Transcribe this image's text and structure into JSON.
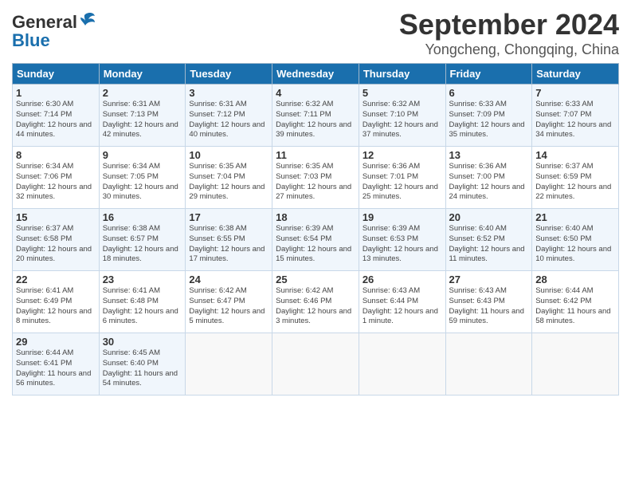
{
  "header": {
    "logo_general": "General",
    "logo_blue": "Blue",
    "month_title": "September 2024",
    "location": "Yongcheng, Chongqing, China"
  },
  "weekdays": [
    "Sunday",
    "Monday",
    "Tuesday",
    "Wednesday",
    "Thursday",
    "Friday",
    "Saturday"
  ],
  "weeks": [
    [
      {
        "day": "1",
        "sunrise": "6:30 AM",
        "sunset": "7:14 PM",
        "daylight": "12 hours and 44 minutes."
      },
      {
        "day": "2",
        "sunrise": "6:31 AM",
        "sunset": "7:13 PM",
        "daylight": "12 hours and 42 minutes."
      },
      {
        "day": "3",
        "sunrise": "6:31 AM",
        "sunset": "7:12 PM",
        "daylight": "12 hours and 40 minutes."
      },
      {
        "day": "4",
        "sunrise": "6:32 AM",
        "sunset": "7:11 PM",
        "daylight": "12 hours and 39 minutes."
      },
      {
        "day": "5",
        "sunrise": "6:32 AM",
        "sunset": "7:10 PM",
        "daylight": "12 hours and 37 minutes."
      },
      {
        "day": "6",
        "sunrise": "6:33 AM",
        "sunset": "7:09 PM",
        "daylight": "12 hours and 35 minutes."
      },
      {
        "day": "7",
        "sunrise": "6:33 AM",
        "sunset": "7:07 PM",
        "daylight": "12 hours and 34 minutes."
      }
    ],
    [
      {
        "day": "8",
        "sunrise": "6:34 AM",
        "sunset": "7:06 PM",
        "daylight": "12 hours and 32 minutes."
      },
      {
        "day": "9",
        "sunrise": "6:34 AM",
        "sunset": "7:05 PM",
        "daylight": "12 hours and 30 minutes."
      },
      {
        "day": "10",
        "sunrise": "6:35 AM",
        "sunset": "7:04 PM",
        "daylight": "12 hours and 29 minutes."
      },
      {
        "day": "11",
        "sunrise": "6:35 AM",
        "sunset": "7:03 PM",
        "daylight": "12 hours and 27 minutes."
      },
      {
        "day": "12",
        "sunrise": "6:36 AM",
        "sunset": "7:01 PM",
        "daylight": "12 hours and 25 minutes."
      },
      {
        "day": "13",
        "sunrise": "6:36 AM",
        "sunset": "7:00 PM",
        "daylight": "12 hours and 24 minutes."
      },
      {
        "day": "14",
        "sunrise": "6:37 AM",
        "sunset": "6:59 PM",
        "daylight": "12 hours and 22 minutes."
      }
    ],
    [
      {
        "day": "15",
        "sunrise": "6:37 AM",
        "sunset": "6:58 PM",
        "daylight": "12 hours and 20 minutes."
      },
      {
        "day": "16",
        "sunrise": "6:38 AM",
        "sunset": "6:57 PM",
        "daylight": "12 hours and 18 minutes."
      },
      {
        "day": "17",
        "sunrise": "6:38 AM",
        "sunset": "6:55 PM",
        "daylight": "12 hours and 17 minutes."
      },
      {
        "day": "18",
        "sunrise": "6:39 AM",
        "sunset": "6:54 PM",
        "daylight": "12 hours and 15 minutes."
      },
      {
        "day": "19",
        "sunrise": "6:39 AM",
        "sunset": "6:53 PM",
        "daylight": "12 hours and 13 minutes."
      },
      {
        "day": "20",
        "sunrise": "6:40 AM",
        "sunset": "6:52 PM",
        "daylight": "12 hours and 11 minutes."
      },
      {
        "day": "21",
        "sunrise": "6:40 AM",
        "sunset": "6:50 PM",
        "daylight": "12 hours and 10 minutes."
      }
    ],
    [
      {
        "day": "22",
        "sunrise": "6:41 AM",
        "sunset": "6:49 PM",
        "daylight": "12 hours and 8 minutes."
      },
      {
        "day": "23",
        "sunrise": "6:41 AM",
        "sunset": "6:48 PM",
        "daylight": "12 hours and 6 minutes."
      },
      {
        "day": "24",
        "sunrise": "6:42 AM",
        "sunset": "6:47 PM",
        "daylight": "12 hours and 5 minutes."
      },
      {
        "day": "25",
        "sunrise": "6:42 AM",
        "sunset": "6:46 PM",
        "daylight": "12 hours and 3 minutes."
      },
      {
        "day": "26",
        "sunrise": "6:43 AM",
        "sunset": "6:44 PM",
        "daylight": "12 hours and 1 minute."
      },
      {
        "day": "27",
        "sunrise": "6:43 AM",
        "sunset": "6:43 PM",
        "daylight": "11 hours and 59 minutes."
      },
      {
        "day": "28",
        "sunrise": "6:44 AM",
        "sunset": "6:42 PM",
        "daylight": "11 hours and 58 minutes."
      }
    ],
    [
      {
        "day": "29",
        "sunrise": "6:44 AM",
        "sunset": "6:41 PM",
        "daylight": "11 hours and 56 minutes."
      },
      {
        "day": "30",
        "sunrise": "6:45 AM",
        "sunset": "6:40 PM",
        "daylight": "11 hours and 54 minutes."
      },
      null,
      null,
      null,
      null,
      null
    ]
  ]
}
